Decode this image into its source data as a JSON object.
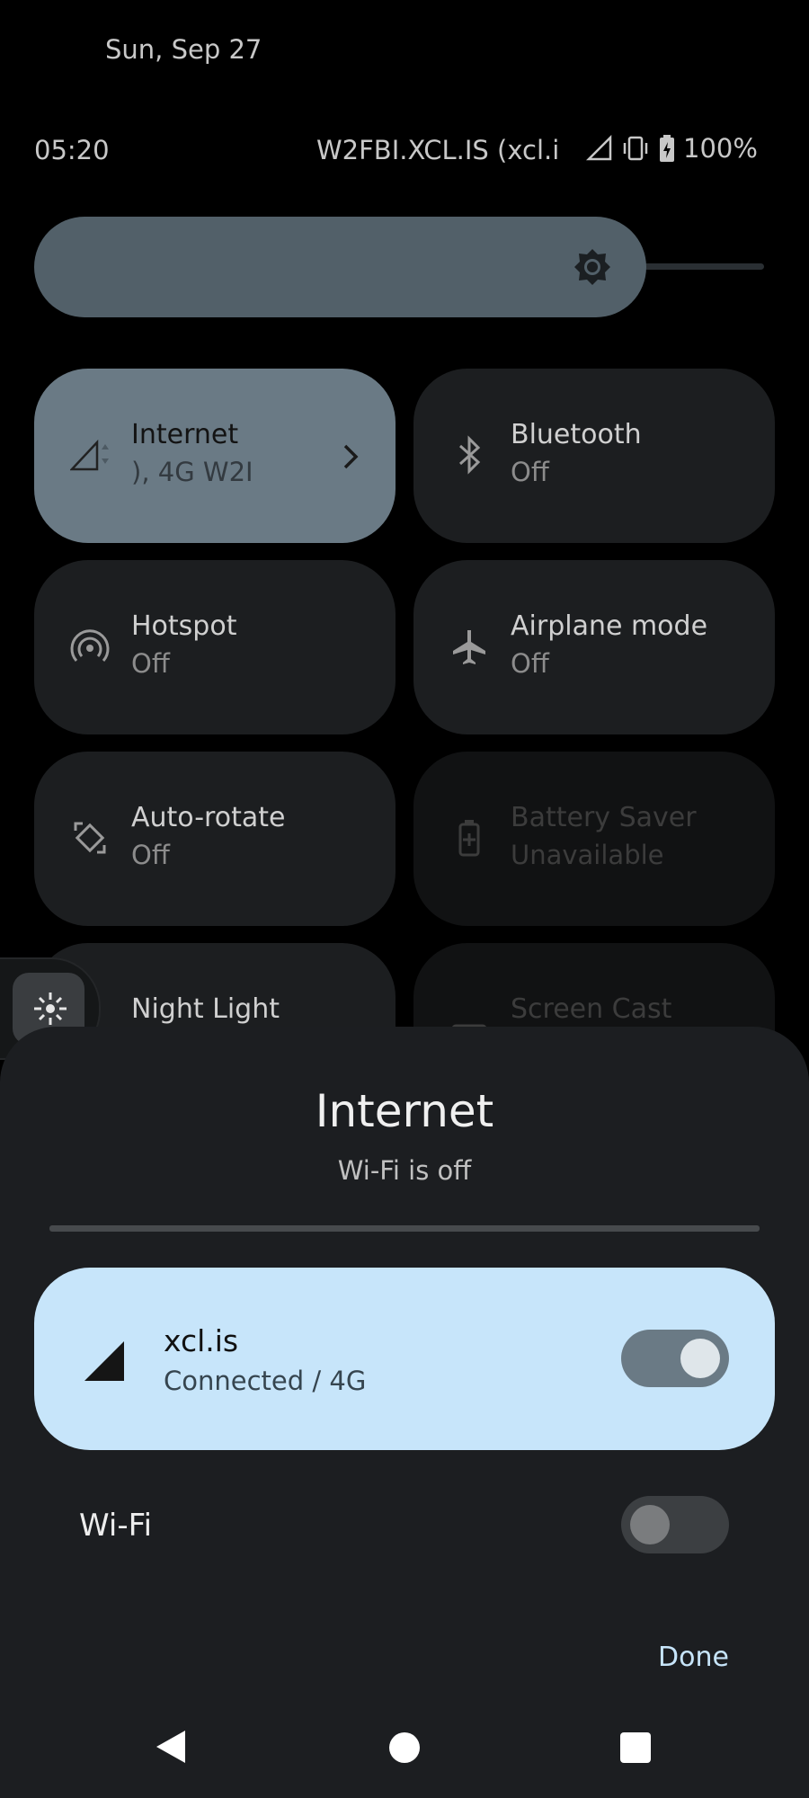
{
  "status_bar": {
    "date": "Sun, Sep 27",
    "time": "05:20",
    "carrier": "W2FBI.XCL.IS (xcl.i",
    "battery": "100%"
  },
  "brightness": {
    "level": 0.88
  },
  "tiles": [
    {
      "label": "Internet",
      "sub": "), 4G      W2I",
      "icon": "signal-icon",
      "state": "active"
    },
    {
      "label": "Bluetooth",
      "sub": "Off",
      "icon": "bluetooth-icon",
      "state": "off"
    },
    {
      "label": "Hotspot",
      "sub": "Off",
      "icon": "hotspot-icon",
      "state": "off"
    },
    {
      "label": "Airplane mode",
      "sub": "Off",
      "icon": "airplane-icon",
      "state": "off"
    },
    {
      "label": "Auto-rotate",
      "sub": "Off",
      "icon": "rotate-icon",
      "state": "off"
    },
    {
      "label": "Battery Saver",
      "sub": "Unavailable",
      "icon": "battery-saver-icon",
      "state": "unavailable"
    },
    {
      "label": "Night Light",
      "sub": "",
      "icon": "night-light-icon",
      "state": "off"
    },
    {
      "label": "Screen Cast",
      "sub": "",
      "icon": "cast-icon",
      "state": "unavailable"
    }
  ],
  "dialog": {
    "title": "Internet",
    "subtitle": "Wi-Fi is off",
    "network": {
      "name": "xcl.is",
      "status": "Connected / 4G",
      "enabled": true
    },
    "wifi": {
      "label": "Wi-Fi",
      "enabled": false
    },
    "done_label": "Done"
  }
}
